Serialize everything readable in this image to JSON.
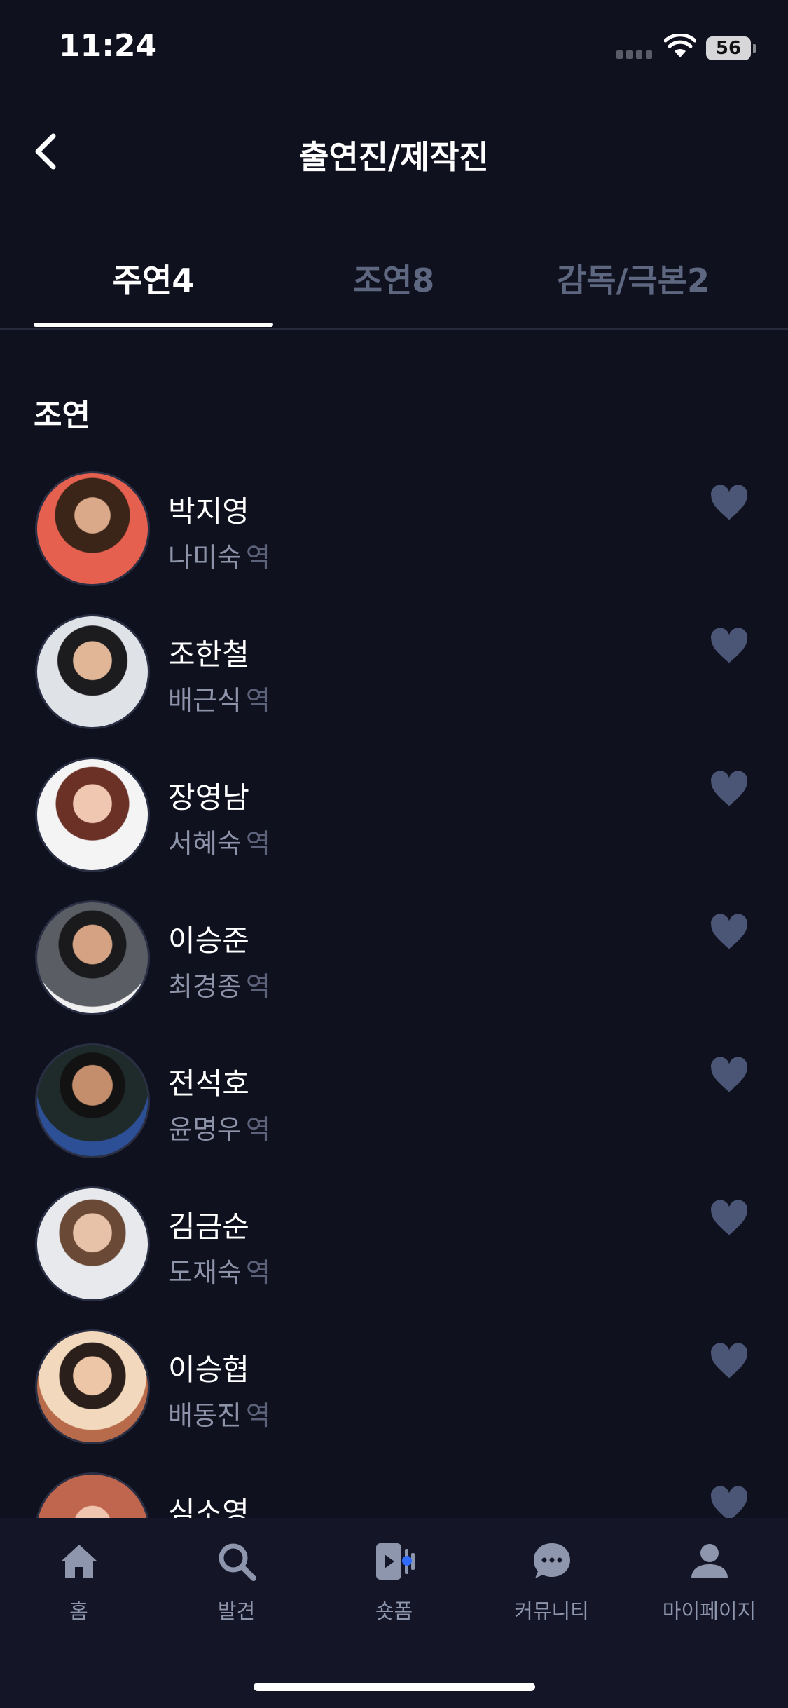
{
  "status_bar": {
    "time": "11:24",
    "battery": "56"
  },
  "header": {
    "title": "출연진/제작진"
  },
  "tabs": [
    {
      "label": "주연4"
    },
    {
      "label": "조연8"
    },
    {
      "label": "감독/극본2"
    }
  ],
  "section_title": "조연",
  "role_suffix": "역",
  "cast": [
    {
      "name": "박지영",
      "role": "나미숙"
    },
    {
      "name": "조한철",
      "role": "배근식"
    },
    {
      "name": "장영남",
      "role": "서혜숙"
    },
    {
      "name": "이승준",
      "role": "최경종"
    },
    {
      "name": "전석호",
      "role": "윤명우"
    },
    {
      "name": "김금순",
      "role": "도재숙"
    },
    {
      "name": "이승협",
      "role": "배동진"
    },
    {
      "name": "심소영",
      "role": ""
    }
  ],
  "bottom_nav": [
    {
      "label": "홈",
      "icon": "home-icon"
    },
    {
      "label": "발견",
      "icon": "search-icon"
    },
    {
      "label": "숏폼",
      "icon": "shortform-icon"
    },
    {
      "label": "커뮤니티",
      "icon": "chat-icon"
    },
    {
      "label": "마이페이지",
      "icon": "profile-icon"
    }
  ],
  "colors": {
    "background": "#10111f",
    "heart": "#4b5677",
    "accent_dot": "#2f6bff"
  }
}
